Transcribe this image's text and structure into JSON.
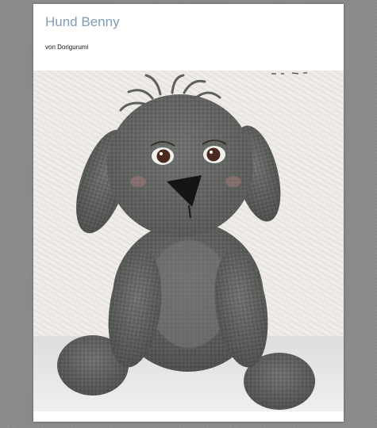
{
  "document": {
    "title": "Hund Benny",
    "byline": "von Dorigurumi"
  },
  "photo": {
    "subject_icon": "crochet-dog-photo"
  },
  "colors": {
    "title": "#7f9db6",
    "background": "#8c8c8c",
    "page": "#ffffff",
    "yarn": "#6b6e6b"
  }
}
